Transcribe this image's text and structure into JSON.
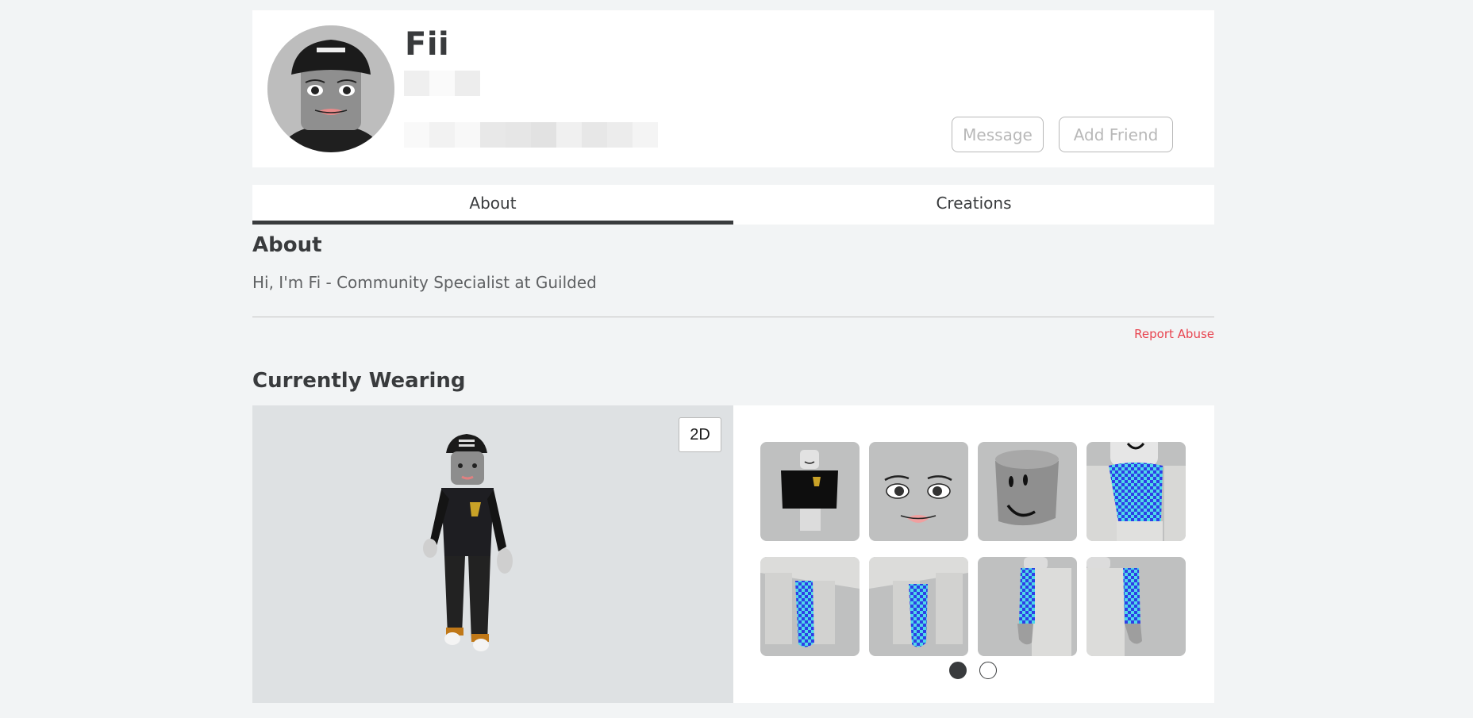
{
  "profile": {
    "display_name": "Fii",
    "avatar_icon": "avatar-headshot",
    "redacted_row_1": [
      "#efefef",
      "#fafafa",
      "#ededed"
    ],
    "redacted_row_2": [
      "#f9f9f9",
      "#f2f2f2",
      "#f8f8f8",
      "#e8e8e8",
      "#e6e6e6",
      "#e2e2e2",
      "#f0f0f0",
      "#e7e7e7",
      "#ececec",
      "#f4f4f4"
    ],
    "buttons": {
      "message": "Message",
      "add_friend": "Add Friend"
    }
  },
  "tabs": [
    {
      "label": "About",
      "active": true
    },
    {
      "label": "Creations",
      "active": false
    }
  ],
  "about": {
    "title": "About",
    "text": "Hi, I'm Fi - Community Specialist at Guilded",
    "report_abuse": "Report Abuse"
  },
  "wearing": {
    "title": "Currently Wearing",
    "toggle_label": "2D",
    "items": [
      {
        "name": "black-hoodie-shirt"
      },
      {
        "name": "face"
      },
      {
        "name": "head"
      },
      {
        "name": "checkered-torso"
      },
      {
        "name": "checkered-right-leg"
      },
      {
        "name": "checkered-left-leg"
      },
      {
        "name": "checkered-left-arm"
      },
      {
        "name": "checkered-right-arm"
      }
    ],
    "pages": 2,
    "current_page": 1
  },
  "colors": {
    "page_bg": "#f2f4f5",
    "text_primary": "#393b3d",
    "report_red": "#e8444f",
    "avatar_panel_bg": "#dee1e3",
    "tile_bg": "#bfc0c0",
    "checker_blue": "#2f3fe6",
    "checker_cyan": "#4fd8e8"
  }
}
